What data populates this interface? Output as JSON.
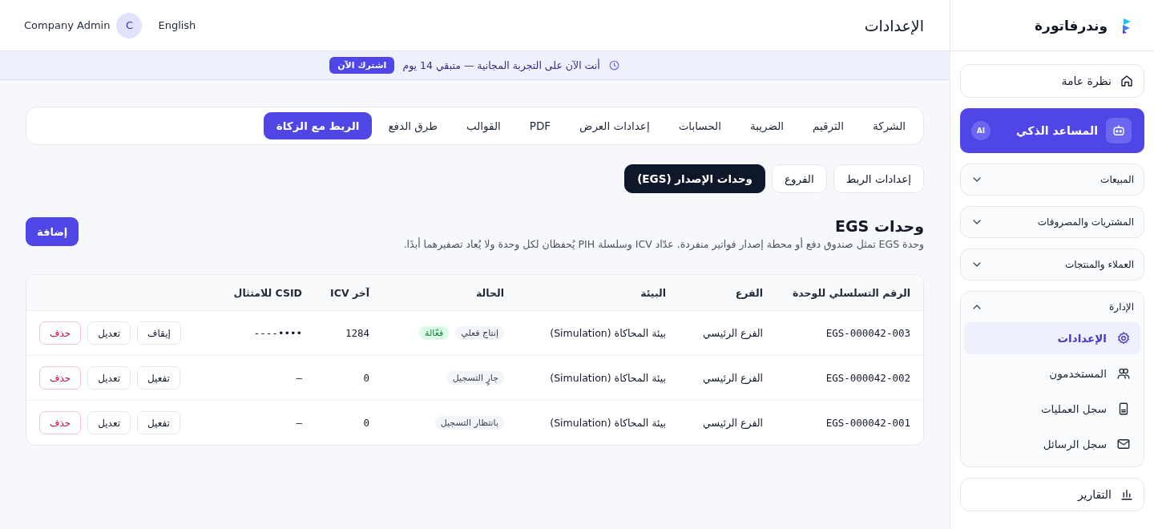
{
  "brand": {
    "name": "وندرفاتورة"
  },
  "sidebar": {
    "items": [
      {
        "kind": "link",
        "label": "نظرة عامة",
        "selected": false
      },
      {
        "kind": "ai",
        "label": "المساعد الذكي",
        "badge": "AI"
      },
      {
        "kind": "group",
        "label": "المبيعات",
        "expanded": false
      },
      {
        "kind": "group",
        "label": "المشتريات والمصروفات",
        "expanded": false
      },
      {
        "kind": "group",
        "label": "العملاء والمنتجات",
        "expanded": false
      },
      {
        "kind": "group",
        "label": "الإدارة",
        "expanded": true,
        "children": [
          {
            "label": "الإعدادات",
            "selected": true
          },
          {
            "label": "المستخدمون",
            "selected": false
          },
          {
            "label": "سجل العمليات",
            "selected": false
          },
          {
            "label": "سجل الرسائل",
            "selected": false
          }
        ]
      },
      {
        "kind": "link",
        "label": "التقارير",
        "selected": false
      }
    ]
  },
  "topbar": {
    "title": "الإعدادات",
    "language": "English",
    "user_name": "Company Admin",
    "avatar_initial": "C"
  },
  "trial_banner": {
    "message": "أنت الآن على التجربة المجانية — متبقي 14 يوم",
    "button": "اشترك الآن"
  },
  "settings": {
    "tabs": [
      {
        "label": "الشركة",
        "selected": false
      },
      {
        "label": "الترقيم",
        "selected": false
      },
      {
        "label": "الضريبة",
        "selected": false
      },
      {
        "label": "الحسابات",
        "selected": false
      },
      {
        "label": "إعدادات العرض",
        "selected": false
      },
      {
        "label": "PDF",
        "selected": false
      },
      {
        "label": "القوالب",
        "selected": false
      },
      {
        "label": "طرق الدفع",
        "selected": false
      },
      {
        "label": "الربط مع الزكاة",
        "selected": true
      }
    ],
    "subtabs": [
      {
        "label": "إعدادات الربط",
        "selected": false
      },
      {
        "label": "الفروع",
        "selected": false
      },
      {
        "label": "وحدات الإصدار (EGS)",
        "selected": true
      }
    ],
    "section": {
      "title": "وحدات EGS",
      "description": "وحدة EGS تمثل صندوق دفع أو محطة إصدار فواتير منفردة. عدّاد ICV وسلسلة PIH يُحفظان لكل وحدة ولا يُعاد تصفيرهما أبدًا.",
      "add_button": "إضافة"
    },
    "table": {
      "columns": [
        "الرقم التسلسلي للوحدة",
        "الفرع",
        "البيئة",
        "الحالة",
        "آخر ICV",
        "CSID للامتثال"
      ],
      "rows": [
        {
          "serial": "EGS-000042-003",
          "branch": "الفرع الرئيسي",
          "environment": "بيئة المحاكاة (Simulation)",
          "status": [
            {
              "label": "إنتاج فعلي",
              "kind": "neutral"
            },
            {
              "label": "فعّالة",
              "kind": "success"
            }
          ],
          "icv": "1284",
          "csid": "----••••",
          "actions": [
            {
              "label": "إيقاف",
              "kind": "default"
            },
            {
              "label": "تعديل",
              "kind": "default"
            },
            {
              "label": "حذف",
              "kind": "danger"
            }
          ]
        },
        {
          "serial": "EGS-000042-002",
          "branch": "الفرع الرئيسي",
          "environment": "بيئة المحاكاة (Simulation)",
          "status": [
            {
              "label": "جارٍ التسجيل",
              "kind": "neutral"
            }
          ],
          "icv": "0",
          "csid": "–",
          "actions": [
            {
              "label": "تفعيل",
              "kind": "default"
            },
            {
              "label": "تعديل",
              "kind": "default"
            },
            {
              "label": "حذف",
              "kind": "danger"
            }
          ]
        },
        {
          "serial": "EGS-000042-001",
          "branch": "الفرع الرئيسي",
          "environment": "بيئة المحاكاة (Simulation)",
          "status": [
            {
              "label": "بانتظار التسجيل",
              "kind": "neutral"
            }
          ],
          "icv": "0",
          "csid": "–",
          "actions": [
            {
              "label": "تفعيل",
              "kind": "default"
            },
            {
              "label": "تعديل",
              "kind": "default"
            },
            {
              "label": "حذف",
              "kind": "danger"
            }
          ]
        }
      ]
    }
  }
}
